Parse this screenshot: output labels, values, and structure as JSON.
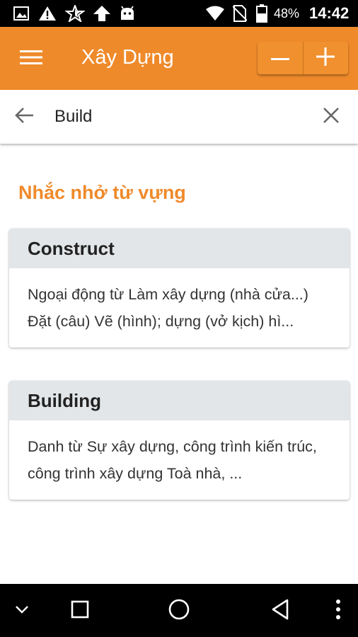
{
  "status_bar": {
    "icons": [
      "image-icon",
      "warning-icon",
      "star-icon",
      "upload-icon",
      "android-icon",
      "wifi-icon",
      "no-sim-icon",
      "battery-icon"
    ],
    "battery_percent": "48%",
    "time": "14:42"
  },
  "app_bar": {
    "title": "Xây Dựng",
    "menu_icon": "menu-icon",
    "zoom_out_icon": "minus-icon",
    "zoom_in_icon": "plus-icon",
    "background_color": "#ef8a2b"
  },
  "search": {
    "value": "Build",
    "back_icon": "arrow-back-icon",
    "clear_icon": "close-icon"
  },
  "section": {
    "title": "Nhắc nhở từ vựng",
    "accent_color": "#ef8a2b"
  },
  "cards": [
    {
      "word": "Construct",
      "definition": "Ngoại động từ Làm xây dựng (nhà cửa...) Đặt (câu) Vẽ (hình); dựng (vở kịch) hì..."
    },
    {
      "word": "Building",
      "definition": "Danh từ Sự xây dựng, công trình kiến trúc, công trình xây dựng Toà nhà, ..."
    }
  ],
  "nav_bar": {
    "icons": [
      "chevron-down-icon",
      "recents-icon",
      "home-icon",
      "back-icon",
      "more-icon"
    ]
  }
}
